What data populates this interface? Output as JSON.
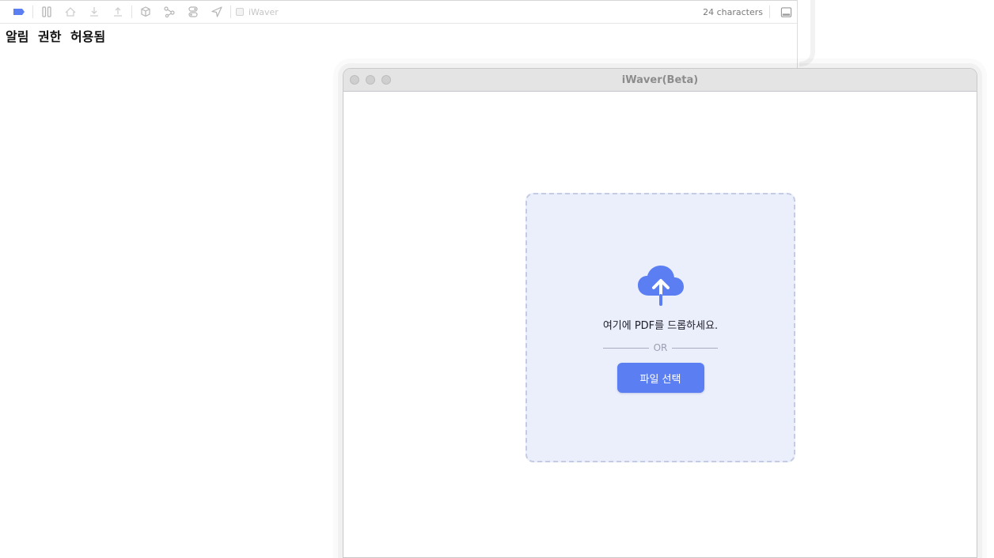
{
  "editor": {
    "char_count": "24 characters",
    "toolbar_doc_name": "iWaver",
    "text": "알림 권한 허용됨",
    "toolbar_icons": [
      "tag-icon",
      "columns-icon",
      "home-icon",
      "download-icon",
      "upload-icon",
      "cube-icon",
      "share-nodes-icon",
      "toggle-stack-icon",
      "send-arrow-icon"
    ],
    "accent_color": "#5b7ff2"
  },
  "app_window": {
    "title": "iWaver(Beta)",
    "dropzone": {
      "icon": "cloud-upload-icon",
      "instruction": "여기에 PDF를 드롭하세요.",
      "or_label": "OR",
      "button_label": "파일 선택"
    },
    "colors": {
      "dropzone_bg": "#ebeffb",
      "button_bg": "#5b7ff2",
      "cloud": "#5b7ff2"
    }
  }
}
